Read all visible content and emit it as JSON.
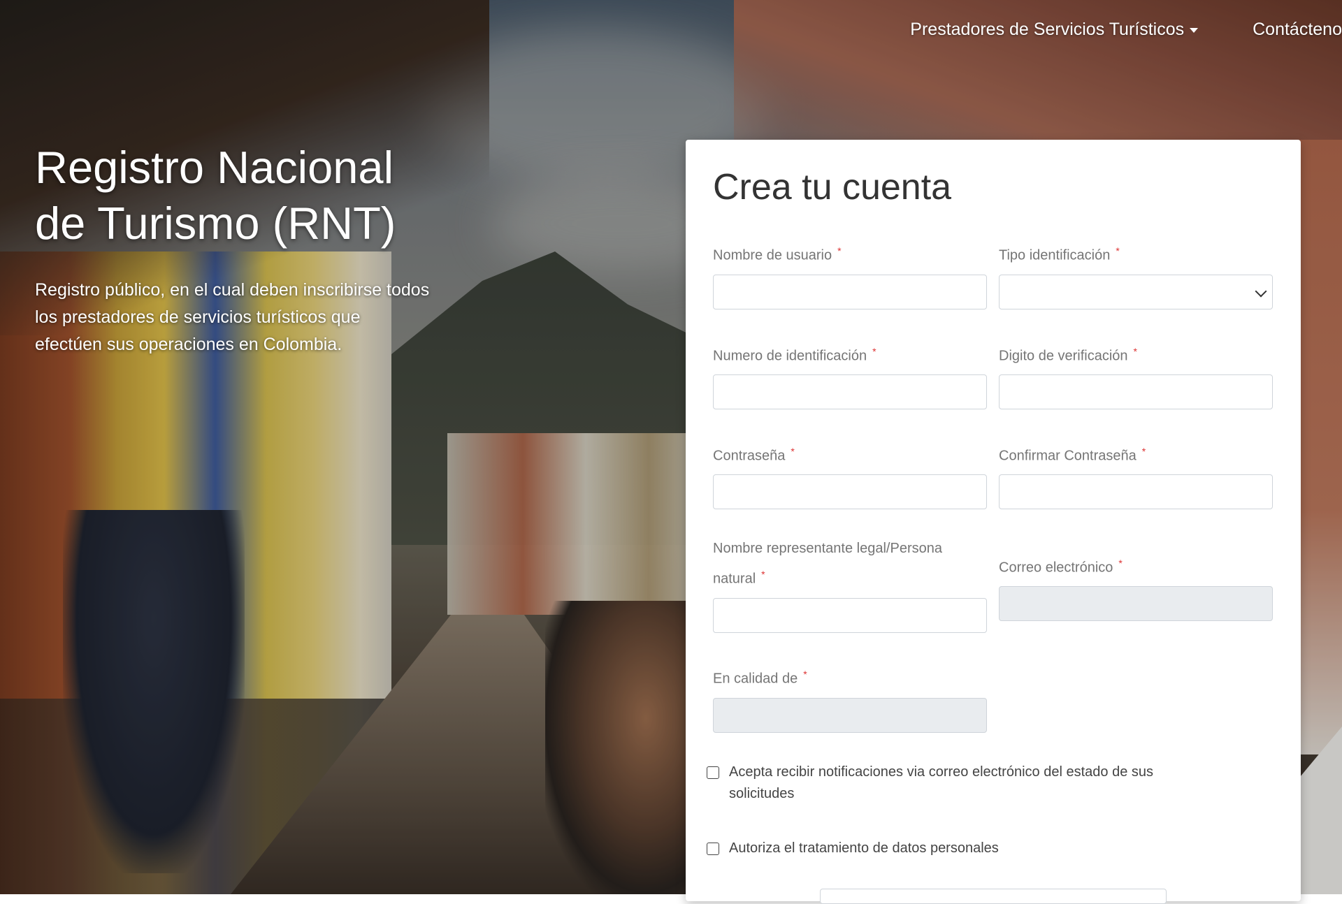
{
  "nav": {
    "items": [
      {
        "label": "Prestadores de Servicios Turísticos",
        "has_dropdown": true
      },
      {
        "label": "Contácteno"
      }
    ]
  },
  "hero": {
    "title_line1": "Registro Nacional",
    "title_line2": "de Turismo (RNT)",
    "description_line1": "Registro público, en el cual deben inscribirse todos",
    "description_line2": "los prestadores de servicios turísticos que",
    "description_line3": "efectúen sus operaciones en Colombia."
  },
  "form": {
    "title": "Crea tu cuenta",
    "fields": {
      "username": {
        "label": "Nombre de usuario",
        "value": ""
      },
      "id_type": {
        "label": "Tipo identificación",
        "value": ""
      },
      "id_number": {
        "label": "Numero de identificación",
        "value": ""
      },
      "verification_digit": {
        "label": "Digito de verificación",
        "value": ""
      },
      "password": {
        "label": "Contraseña",
        "value": ""
      },
      "confirm_password": {
        "label": "Confirmar Contraseña",
        "value": ""
      },
      "legal_rep_line1": "Nombre representante legal/Persona",
      "legal_rep_line2": "natural",
      "legal_rep": {
        "value": ""
      },
      "email": {
        "label": "Correo electrónico",
        "value": ""
      },
      "capacity": {
        "label": "En calidad de",
        "value": ""
      }
    },
    "required_mark": "*",
    "checkboxes": {
      "notifications_line1": "Acepta recibir notificaciones via correo electrónico del estado de sus",
      "notifications_line2": "solicitudes",
      "data_treatment": "Autoriza el tratamiento de datos personales"
    }
  },
  "colors": {
    "required": "#dd3333",
    "label": "#757575",
    "disabled_field": "#e9ecef"
  }
}
